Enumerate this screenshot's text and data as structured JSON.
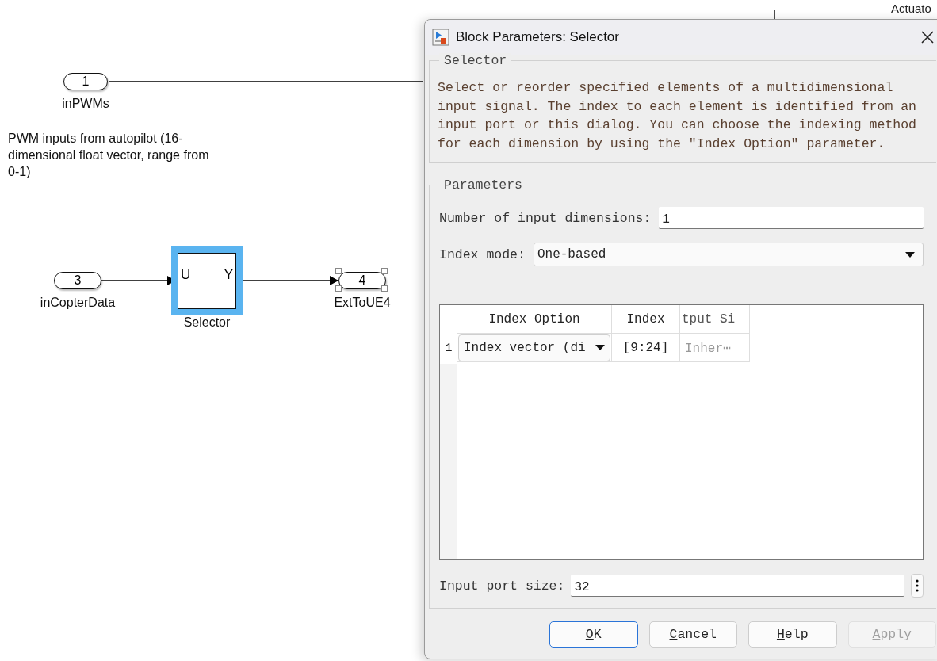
{
  "diagram": {
    "blocks": [
      {
        "kind": "inport",
        "number": "1",
        "label": "inPWMs",
        "selected": false
      },
      {
        "kind": "inport",
        "number": "3",
        "label": "inCopterData",
        "selected": false
      },
      {
        "kind": "selector",
        "input_port": "U",
        "output_port": "Y",
        "label": "Selector",
        "highlighted": true
      },
      {
        "kind": "outport",
        "number": "4",
        "label": "ExtToUE4",
        "selected": true
      }
    ],
    "annotation": "PWM inputs from autopilot (16-dimensional float vector, range from 0-1)",
    "background_label": "Actuato"
  },
  "dialog": {
    "title": "Block Parameters: Selector",
    "description_group": {
      "title": "Selector",
      "text": "Select or reorder specified elements of a multidimensional input signal. The index to each element is identified from an input port or this dialog. You can choose the indexing method for each dimension by using the \"Index Option\" parameter."
    },
    "parameters_group": {
      "title": "Parameters",
      "num_dimensions": {
        "label": "Number of input dimensions:",
        "value": "1"
      },
      "index_mode": {
        "label": "Index mode:",
        "value": "One-based"
      },
      "table": {
        "columns": [
          "Index Option",
          "Index",
          "tput Si"
        ],
        "rows": [
          {
            "number": "1",
            "index_option": "Index vector (di",
            "index": "[9:24]",
            "output_size": "Inher⋯"
          }
        ]
      },
      "input_port_size": {
        "label": "Input port size:",
        "value": "32"
      }
    },
    "buttons": [
      {
        "label": "OK",
        "mnemonic": true,
        "default": true,
        "disabled": false
      },
      {
        "label": "Cancel",
        "mnemonic": true,
        "default": false,
        "disabled": false
      },
      {
        "label": "Help",
        "mnemonic": true,
        "default": false,
        "disabled": false
      },
      {
        "label": "Apply",
        "mnemonic": true,
        "default": false,
        "disabled": true
      }
    ]
  }
}
